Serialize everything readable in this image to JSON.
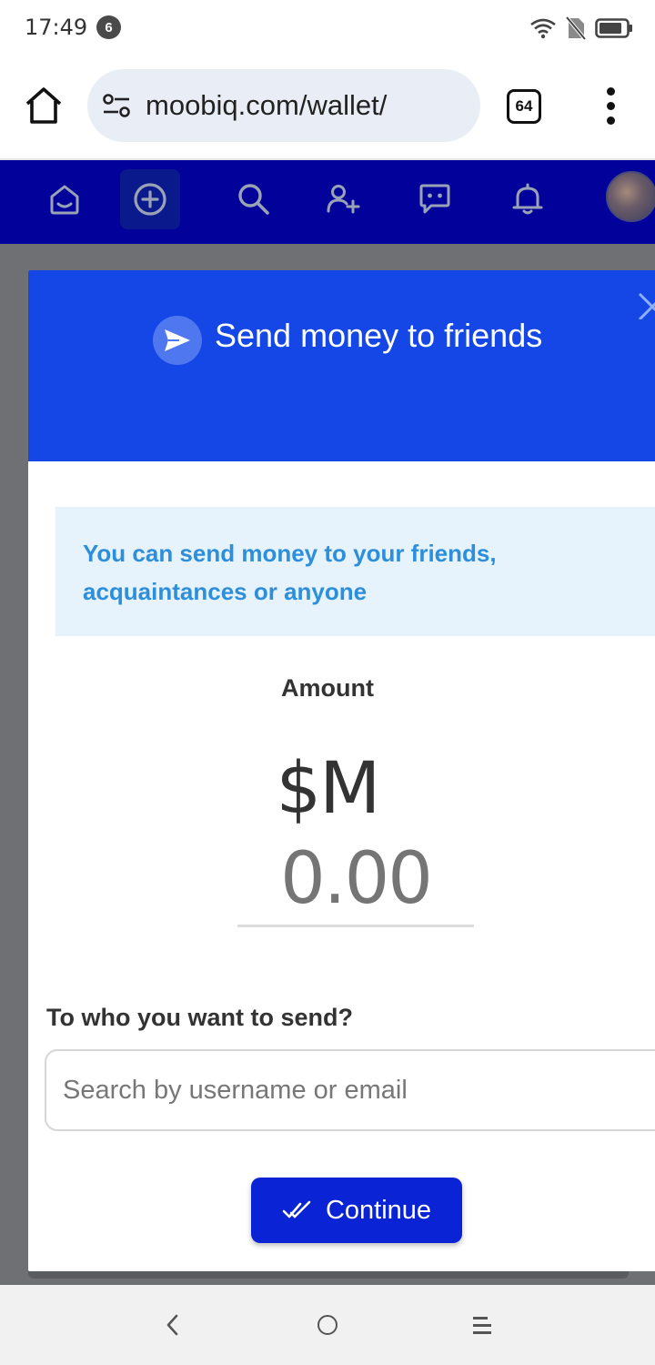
{
  "status_bar": {
    "time": "17:49",
    "notification_count": "6",
    "icons": [
      "wifi-icon",
      "no-sim-icon",
      "battery-icon"
    ]
  },
  "browser": {
    "url": "moobiq.com/wallet/",
    "tab_count": "64",
    "icons": [
      "home-icon",
      "site-settings-icon",
      "more-vert-icon"
    ]
  },
  "site_nav": {
    "items": [
      {
        "name": "home",
        "icon": "home-smile-icon"
      },
      {
        "name": "create",
        "icon": "plus-circle-icon",
        "active": true
      },
      {
        "name": "search",
        "icon": "search-icon"
      },
      {
        "name": "add-friend",
        "icon": "user-plus-icon"
      },
      {
        "name": "messages",
        "icon": "chat-icon"
      },
      {
        "name": "notifications",
        "icon": "bell-icon"
      },
      {
        "name": "profile",
        "icon": "avatar"
      }
    ],
    "background": "#02029a"
  },
  "modal": {
    "title": "Send money to friends",
    "header_color": "#1546e6",
    "info_text": "You can send money to your friends, acquaintances or anyone",
    "amount_label": "Amount",
    "currency": "$M",
    "amount_placeholder": "0.00",
    "recipient_label": "To who you want to send?",
    "recipient_placeholder": "Search by username or email",
    "continue_label": "Continue",
    "button_color": "#0a23d4"
  }
}
